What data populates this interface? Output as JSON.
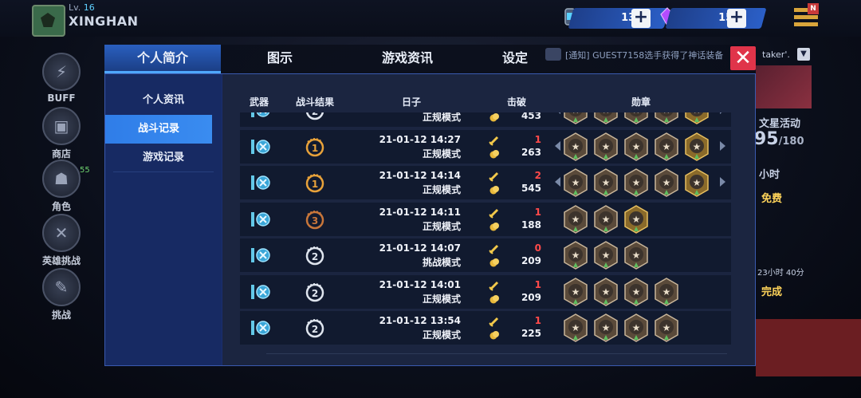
{
  "player": {
    "level_prefix": "Lv.",
    "level": "16",
    "name": "XINGHAN"
  },
  "currencies": [
    {
      "name": "energy",
      "value": "132",
      "icon": "energy-drink-icon",
      "color": "#2b5fc7"
    },
    {
      "name": "gems",
      "value": "153",
      "icon": "purple-crystal-icon",
      "color": "#2b5fc7"
    }
  ],
  "menu_badge": "N",
  "side_buttons": [
    {
      "label": "BUFF",
      "icon": "buff-icon"
    },
    {
      "label": "商店",
      "icon": "shop-icon"
    },
    {
      "label": "角色",
      "icon": "character-icon",
      "count": "55"
    },
    {
      "label": "英雄挑战",
      "icon": "hero-challenge-icon"
    },
    {
      "label": "挑战",
      "icon": "challenge-icon"
    }
  ],
  "right_panel": {
    "event": "文星活动",
    "progress": "95",
    "progress_total": "/180",
    "hours": "小时",
    "free": "免费",
    "timer": "23小时 40分",
    "complete": "完成",
    "notice_name": "taker'."
  },
  "tabs": [
    "个人简介",
    "图示",
    "游戏资讯",
    "设定"
  ],
  "active_tab": 0,
  "notice": "[通知] GUEST7158选手获得了神话装备",
  "left_nav": [
    "个人资讯",
    "战斗记录",
    "游戏记录"
  ],
  "active_nav": 1,
  "columns": {
    "weapon": "武器",
    "result": "战斗结果",
    "date": "日子",
    "kills": "击破",
    "badges": "勋章"
  },
  "records": [
    {
      "rank": 2,
      "date": "",
      "mode": "正规模式",
      "kills": "",
      "score": "453",
      "badges": [
        "pickaxe-badge",
        "angel-badge",
        "hand-badge",
        "hand-badge",
        "helmet-badge"
      ],
      "has_arrows": true,
      "partial": true
    },
    {
      "rank": 1,
      "date": "21-01-12 14:27",
      "mode": "正规模式",
      "kills": "1",
      "score": "263",
      "badges": [
        "pickaxe-badge",
        "angel-badge",
        "hand-badge",
        "wings-badge",
        "helmet-badge"
      ],
      "has_arrows": true
    },
    {
      "rank": 1,
      "date": "21-01-12 14:14",
      "mode": "正规模式",
      "kills": "2",
      "score": "545",
      "badges": [
        "pickaxe-badge",
        "angel-badge",
        "wings-badge",
        "hand-badge",
        "helmet-badge"
      ],
      "has_arrows": true
    },
    {
      "rank": 3,
      "date": "21-01-12 14:11",
      "mode": "正规模式",
      "kills": "1",
      "score": "188",
      "badges": [
        "pickaxe-badge",
        "cart-badge",
        "cross-badge"
      ],
      "has_arrows": false
    },
    {
      "rank": 2,
      "date": "21-01-12 14:07",
      "mode": "挑战模式",
      "kills": "0",
      "score": "209",
      "badges": [
        "pickaxe-badge",
        "angel-badge",
        "cart-badge"
      ],
      "has_arrows": false
    },
    {
      "rank": 2,
      "date": "21-01-12 14:01",
      "mode": "正规模式",
      "kills": "1",
      "score": "209",
      "badges": [
        "pickaxe-badge",
        "angel-badge",
        "cart-badge",
        "hand-badge"
      ],
      "has_arrows": false
    },
    {
      "rank": 2,
      "date": "21-01-12 13:54",
      "mode": "正规模式",
      "kills": "1",
      "score": "225",
      "badges": [
        "pickaxe-badge",
        "wings-badge",
        "hand-badge",
        "wings-badge"
      ],
      "has_arrows": false
    }
  ],
  "colors": {
    "accent": "#2f7de8",
    "kill": "#ff4a4a",
    "close": "#e0344a",
    "gold": "#e8a23a",
    "panel": "#1a2f6e"
  }
}
